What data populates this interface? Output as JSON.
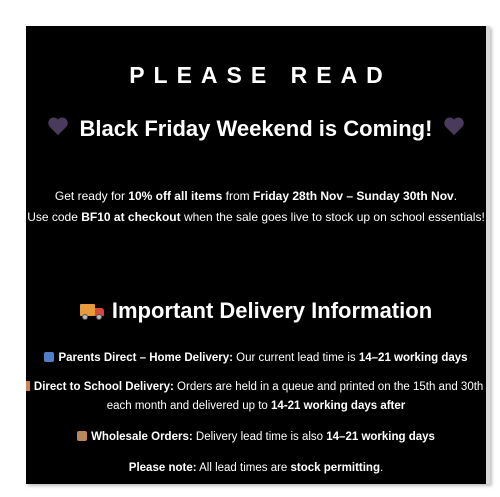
{
  "heading": "PLEASE READ",
  "black_friday": {
    "icon_left": "purple-heart-icon",
    "title": "Black Friday Weekend is Coming!",
    "icon_right": "purple-heart-icon"
  },
  "promo": {
    "line1_a": "Get ready for ",
    "line1_b": "10% off all items",
    "line1_c": " from ",
    "line1_d": "Friday 28th Nov – Sunday 30th Nov",
    "line1_e": ".",
    "line2_a": "Use code ",
    "line2_b": "BF10 at checkout",
    "line2_c": " when the sale goes live to stock up on school essentials!"
  },
  "delivery": {
    "icon": "delivery-truck-icon",
    "title": "Important Delivery Information",
    "parents": {
      "icon": "mailbox-icon",
      "label": "Parents Direct – Home Delivery:",
      "text": " Our current lead time is ",
      "value": "14–21 working days"
    },
    "school": {
      "icon": "school-icon",
      "label": "Direct to School Delivery:",
      "text": " Orders are held in a queue and printed on the 15th and 30th of",
      "text2": "each month and delivered up to ",
      "value": "14-21 working days after"
    },
    "wholesale": {
      "icon": "package-icon",
      "label": "Wholesale Orders:",
      "text": " Delivery lead time is also ",
      "value": "14–21 working days"
    },
    "note": {
      "label": "Please note:",
      "text": " All lead times are ",
      "value": "stock permitting",
      "end": "."
    }
  },
  "colors": {
    "panel_background": "#000000",
    "text": "#ffffff",
    "heart": "#4a3a5c"
  }
}
